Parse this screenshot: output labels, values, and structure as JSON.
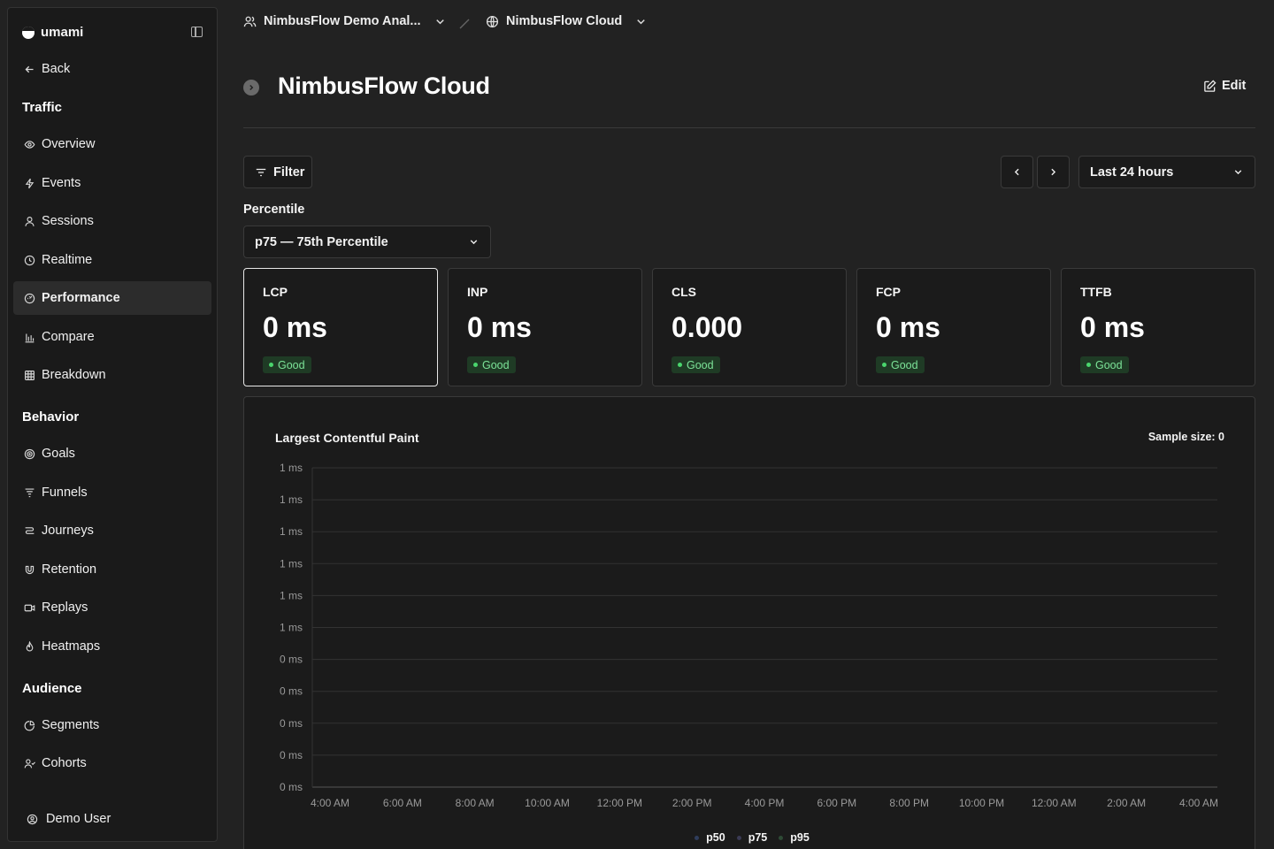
{
  "sidebar": {
    "brand": "umami",
    "back": "Back",
    "sections": {
      "traffic": "Traffic",
      "behavior": "Behavior",
      "audience": "Audience"
    },
    "traffic_items": [
      "Overview",
      "Events",
      "Sessions",
      "Realtime",
      "Performance",
      "Compare",
      "Breakdown"
    ],
    "behavior_items": [
      "Goals",
      "Funnels",
      "Journeys",
      "Retention",
      "Replays",
      "Heatmaps"
    ],
    "audience_items": [
      "Segments",
      "Cohorts"
    ],
    "active_item": "Performance",
    "user": "Demo User"
  },
  "breadcrumb": {
    "team": "NimbusFlow Demo Anal...",
    "website": "NimbusFlow Cloud"
  },
  "page": {
    "title": "NimbusFlow Cloud",
    "edit_label": "Edit"
  },
  "toolbar": {
    "filter_label": "Filter",
    "date_range": "Last 24 hours",
    "percentile_label": "Percentile",
    "percentile_value": "p75 — 75th Percentile"
  },
  "metrics": [
    {
      "label": "LCP",
      "value": "0 ms",
      "status": "Good"
    },
    {
      "label": "INP",
      "value": "0 ms",
      "status": "Good"
    },
    {
      "label": "CLS",
      "value": "0.000",
      "status": "Good"
    },
    {
      "label": "FCP",
      "value": "0 ms",
      "status": "Good"
    },
    {
      "label": "TTFB",
      "value": "0 ms",
      "status": "Good"
    }
  ],
  "colors": {
    "good_text": "#7ce398",
    "good_bg": "#1f3b25",
    "p50": "#2f3d5c",
    "p75": "#3a3a54",
    "p95": "#2e4a35"
  },
  "chart_data": {
    "type": "line",
    "title": "Largest Contentful Paint",
    "sample_size": "Sample size: 0",
    "y_tick_labels": [
      "1 ms",
      "1 ms",
      "1 ms",
      "1 ms",
      "1 ms",
      "1 ms",
      "0 ms",
      "0 ms",
      "0 ms",
      "0 ms",
      "0 ms"
    ],
    "x_tick_labels": [
      "4:00 AM",
      "6:00 AM",
      "8:00 AM",
      "10:00 AM",
      "12:00 PM",
      "2:00 PM",
      "4:00 PM",
      "6:00 PM",
      "8:00 PM",
      "10:00 PM",
      "12:00 AM",
      "2:00 AM",
      "4:00 AM"
    ],
    "series": [
      {
        "name": "p50",
        "values": []
      },
      {
        "name": "p75",
        "values": []
      },
      {
        "name": "p95",
        "values": []
      }
    ],
    "grid": true,
    "legend": "bottom"
  }
}
